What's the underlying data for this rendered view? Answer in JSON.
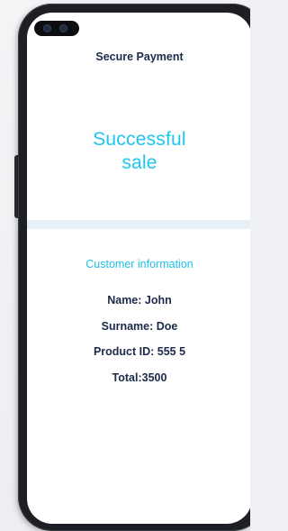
{
  "header": {
    "title": "Secure Payment"
  },
  "status": {
    "message_line1": "Successful",
    "message_line2": "sale"
  },
  "customer": {
    "section_title": "Customer information",
    "name": "Name: John",
    "surname": "Surname: Doe",
    "product_id": "Product ID: 555 5",
    "total": "Total:3500"
  },
  "colors": {
    "accent": "#1cc6ee",
    "text_dark": "#1c2a4a",
    "divider": "#e7f0f8"
  }
}
